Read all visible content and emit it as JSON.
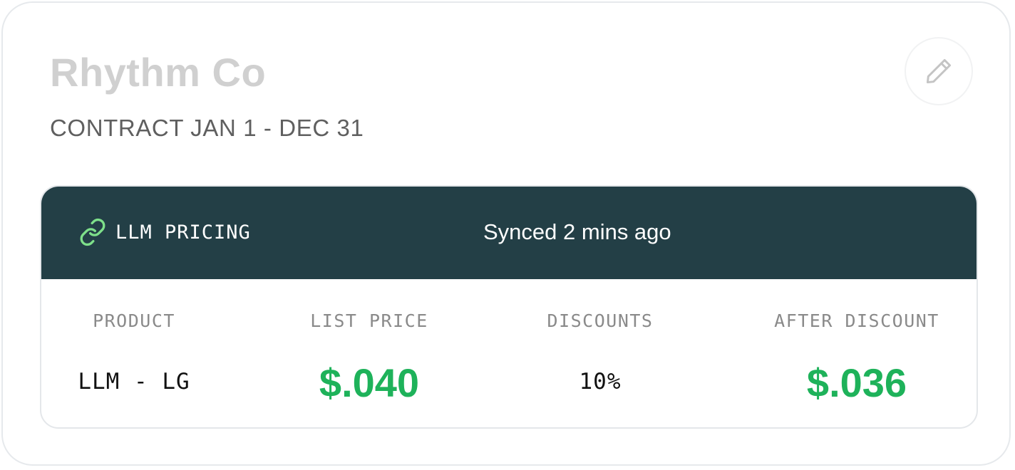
{
  "company": {
    "name": "Rhythm Co",
    "contract_label": "CONTRACT JAN 1 - DEC 31"
  },
  "edit_button": {
    "icon": "pencil-icon"
  },
  "pricing": {
    "header_icon": "link-icon",
    "header_label": "LLM PRICING",
    "sync_status": "Synced 2 mins ago",
    "columns": [
      "PRODUCT",
      "LIST PRICE",
      "DISCOUNTS",
      "AFTER DISCOUNT"
    ],
    "row": {
      "product": "LLM - LG",
      "list_price": "$.040",
      "discount": "10%",
      "after_discount": "$.036"
    }
  },
  "colors": {
    "header_bg": "#233f46",
    "price_green": "#1eb25a",
    "link_icon_green": "#7ee08a",
    "title_gray": "#d0d0d0"
  }
}
